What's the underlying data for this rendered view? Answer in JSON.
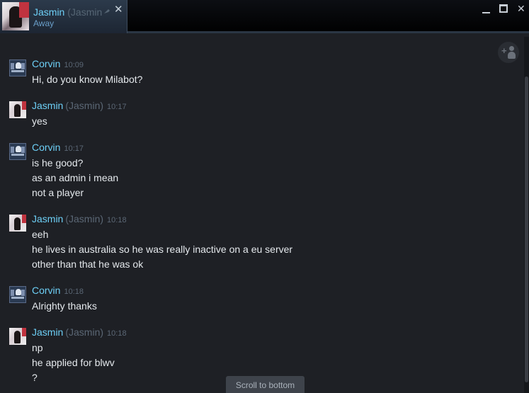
{
  "tab": {
    "name": "Jasmin",
    "nickname": "(Jasmin",
    "status": "Away",
    "close_glyph": "✕"
  },
  "window": {
    "minimize": "minimize-icon",
    "maximize": "maximize-icon",
    "close_glyph": "✕"
  },
  "messages": [
    {
      "sender": "Corvin",
      "alias": "",
      "time": "10:09",
      "lines": [
        "Hi, do you know Milabot?"
      ]
    },
    {
      "sender": "Jasmin",
      "alias": "(Jasmin)",
      "time": "10:17",
      "lines": [
        "yes"
      ]
    },
    {
      "sender": "Corvin",
      "alias": "",
      "time": "10:17",
      "lines": [
        "is he good?",
        "as an admin i mean",
        "not a player"
      ]
    },
    {
      "sender": "Jasmin",
      "alias": "(Jasmin)",
      "time": "10:18",
      "lines": [
        "eeh",
        "he lives in australia so he was really inactive on a eu server",
        "other than that he was ok"
      ]
    },
    {
      "sender": "Corvin",
      "alias": "",
      "time": "10:18",
      "lines": [
        "Alrighty thanks"
      ]
    },
    {
      "sender": "Jasmin",
      "alias": "(Jasmin)",
      "time": "10:18",
      "lines": [
        "np",
        "he applied for blwv",
        "?"
      ]
    }
  ],
  "scroll_button": "Scroll to bottom",
  "colors": {
    "accent": "#6dcff6",
    "background": "#1e2025",
    "text": "#e4e8ec",
    "muted": "#5b6775"
  }
}
